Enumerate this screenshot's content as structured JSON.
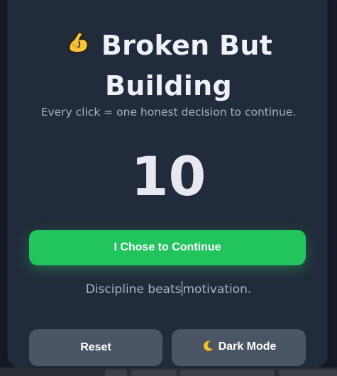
{
  "app": {
    "title_line1": "Broken But",
    "title_line2": "Building",
    "title_icon": "flexed-biceps-icon",
    "subtitle": "Every click = one honest decision to continue.",
    "counter": "10",
    "continue_label": "I Chose to Continue",
    "quote_part1": "Discipline beats",
    "quote_part2": "motivation.",
    "reset_label": "Reset",
    "dark_mode_label": "Dark Mode",
    "dark_mode_icon": "crescent-moon-icon"
  },
  "colors": {
    "background": "#161d28",
    "card": "#222b3b",
    "accent_green": "#22c45e",
    "secondary_button": "#4b5563",
    "text_primary": "#eef1f6",
    "text_muted": "#a9b3c4"
  }
}
